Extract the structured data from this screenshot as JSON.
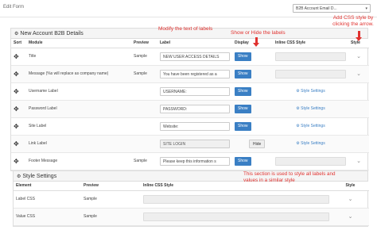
{
  "window": {
    "title": "Edit Form",
    "form_select_value": "B2B Account Email D..."
  },
  "details_panel": {
    "title": "New Account B2B Details",
    "columns": [
      "Sort",
      "Module",
      "Preview",
      "Label",
      "Display",
      "Inline CSS Style",
      "Style"
    ],
    "rows": [
      {
        "module": "Title",
        "preview": "Sample",
        "label": "NEW USER ACCESS DETAILS",
        "label_disabled": false,
        "display": "Show",
        "css": "",
        "style": "chevron"
      },
      {
        "module": "Message (%s will replace as company name)",
        "preview": "Sample",
        "label": "You have been registered as a",
        "label_disabled": false,
        "display": "Show",
        "css": "",
        "style": "chevron"
      },
      {
        "module": "Username Label",
        "preview": "",
        "label": "USERNAME:",
        "label_disabled": false,
        "display": "Show",
        "css": "Style Settings",
        "style": ""
      },
      {
        "module": "Password Label",
        "preview": "",
        "label": "PASSWORD:",
        "label_disabled": false,
        "display": "Show",
        "css": "Style Settings",
        "style": ""
      },
      {
        "module": "Site Label",
        "preview": "",
        "label": "Website:",
        "label_disabled": false,
        "display": "Show",
        "css": "Style Settings",
        "style": ""
      },
      {
        "module": "Link Label",
        "preview": "",
        "label": "SITE LOGIN",
        "label_disabled": true,
        "display": "Hide",
        "css": "Style Settings",
        "style": ""
      },
      {
        "module": "Footer Message",
        "preview": "Sample",
        "label": "Please keep this information s",
        "label_disabled": false,
        "display": "Show",
        "css": "",
        "style": "chevron"
      }
    ]
  },
  "style_panel": {
    "title": "Style Settings",
    "columns": [
      "Element",
      "Preview",
      "Inline CSS Style",
      "Style"
    ],
    "rows": [
      {
        "element": "Label CSS",
        "preview": "Sample"
      },
      {
        "element": "Value CSS",
        "preview": "Sample"
      }
    ]
  },
  "annotations": {
    "label_note": "Modify the text of labels",
    "display_note": "Show or Hide the labels",
    "style_note": "Add CSS style by clicking the arrow.",
    "section_note": "This section is used to style all labels and values in a similar style"
  },
  "icons": {
    "move": "move-arrows-icon",
    "gear": "gear-icon",
    "chevron": "chevron-down-icon",
    "select_caret": "caret-down-icon"
  },
  "colors": {
    "primary_button": "#3a7fc4",
    "annotation": "#e0322f",
    "link": "#3a7fc4"
  }
}
